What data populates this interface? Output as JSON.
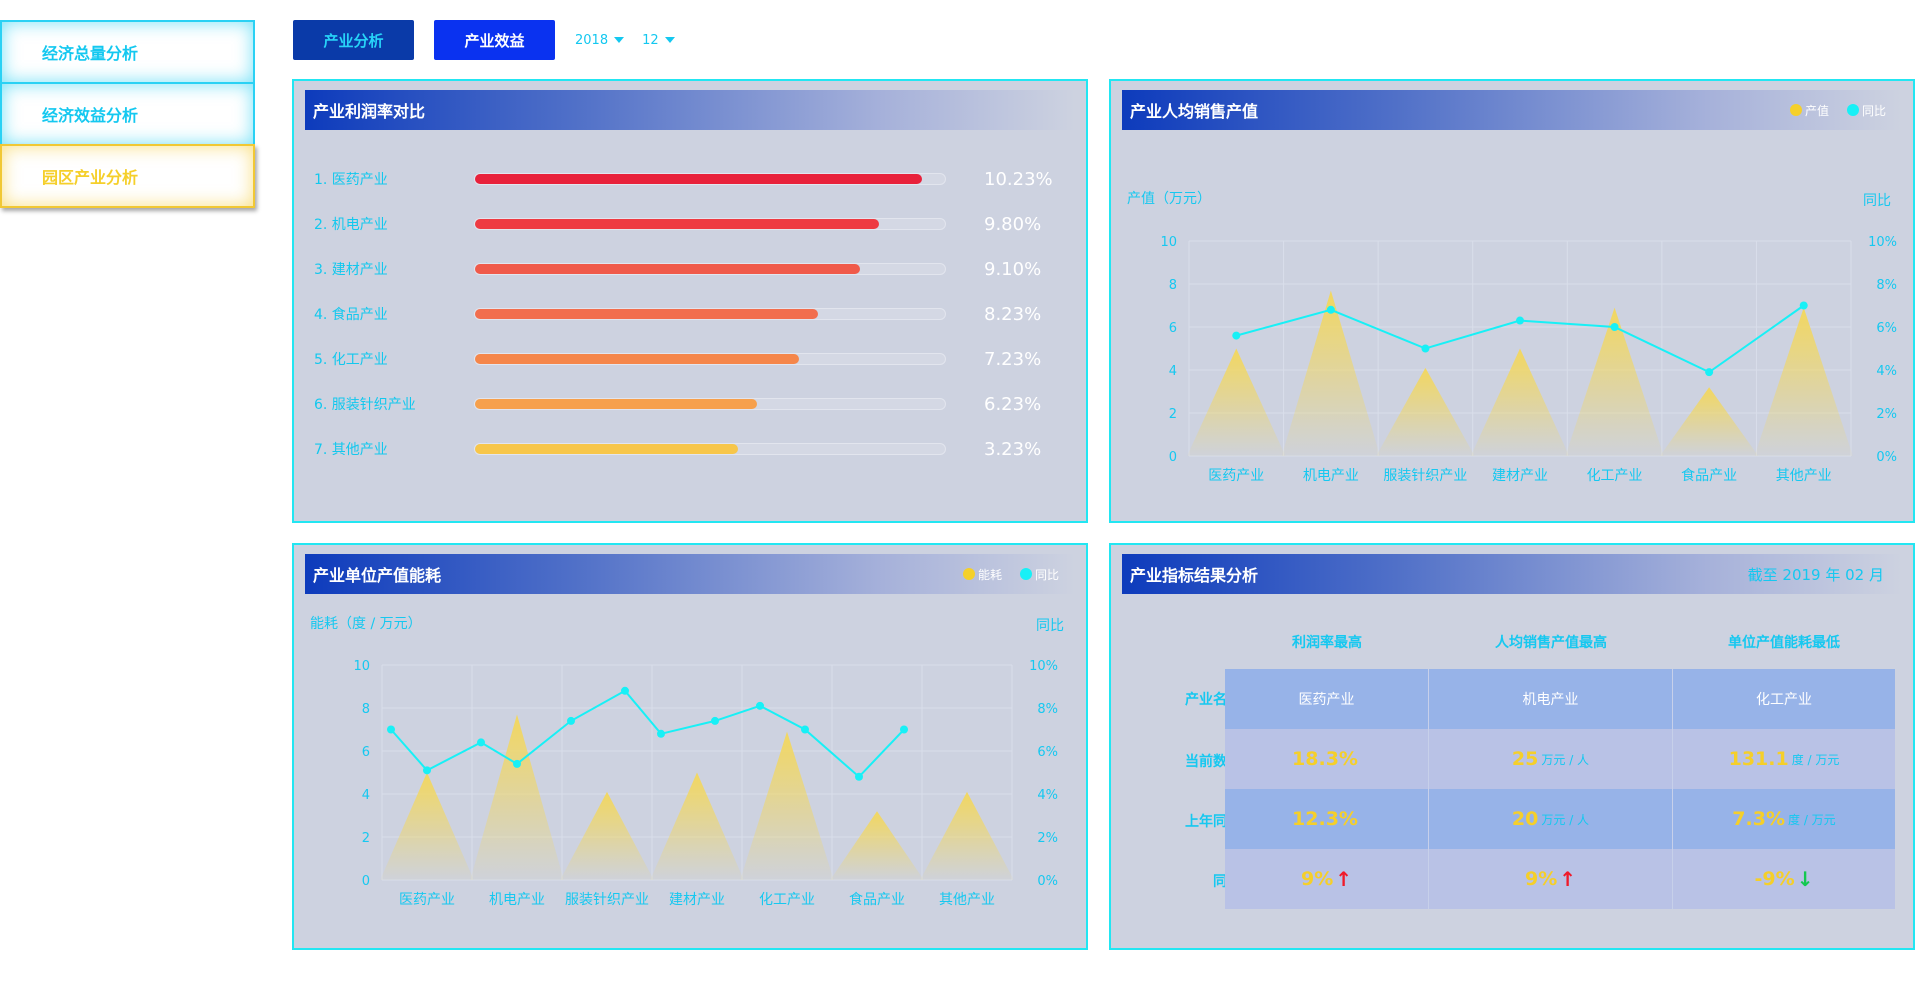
{
  "sidebar": {
    "items": [
      {
        "label": "经济总量分析"
      },
      {
        "label": "经济效益分析"
      },
      {
        "label": "园区产业分析"
      }
    ]
  },
  "top": {
    "tab_analysis": "产业分析",
    "tab_benefit": "产业效益",
    "year": "2018",
    "month": "12"
  },
  "profit_panel": {
    "title": "产业利润率对比",
    "items": [
      {
        "label": "1. 医药产业",
        "value": "10.23%",
        "fill": 0.95,
        "color": "#e8213b"
      },
      {
        "label": "2. 机电产业",
        "value": "9.80%",
        "fill": 0.86,
        "color": "#ee3a42"
      },
      {
        "label": "3. 建材产业",
        "value": "9.10%",
        "fill": 0.82,
        "color": "#f05a4a"
      },
      {
        "label": "4. 食品产业",
        "value": "8.23%",
        "fill": 0.73,
        "color": "#f26e4e"
      },
      {
        "label": "5. 化工产业",
        "value": "7.23%",
        "fill": 0.69,
        "color": "#f5864a"
      },
      {
        "label": "6. 服装针织产业",
        "value": "6.23%",
        "fill": 0.6,
        "color": "#f6a04c"
      },
      {
        "label": "7. 其他产业",
        "value": "3.23%",
        "fill": 0.56,
        "color": "#f7c64a"
      }
    ]
  },
  "sales_panel": {
    "title": "产业人均销售产值",
    "legend": [
      "产值",
      "同比"
    ],
    "y_left_label": "产值（万元）",
    "y_right_label": "同比"
  },
  "energy_panel": {
    "title": "产业单位产值能耗",
    "legend": [
      "能耗",
      "同比"
    ],
    "y_left_label": "能耗（度 / 万元）",
    "y_right_label": "同比"
  },
  "chart_data": [
    {
      "type": "bar",
      "title": "产业人均销售产值",
      "categories": [
        "医药产业",
        "机电产业",
        "服装针织产业",
        "建材产业",
        "化工产业",
        "食品产业",
        "其他产业"
      ],
      "series": [
        {
          "name": "产值",
          "values": [
            5,
            7.7,
            4.1,
            5,
            6.9,
            3.2,
            6.9
          ],
          "axis": "left"
        },
        {
          "name": "同比",
          "values": [
            5.6,
            6.8,
            5.0,
            6.3,
            6.0,
            3.9,
            7.0
          ],
          "axis": "right"
        }
      ],
      "ylim": [
        0,
        10
      ],
      "y_ticks": [
        "0",
        "2",
        "4",
        "6",
        "8",
        "10"
      ],
      "y2_ticks": [
        "0%",
        "2%",
        "4%",
        "6%",
        "8%",
        "10%"
      ],
      "colors": {
        "bar": "#f2d760",
        "line": "#18f0f6"
      }
    },
    {
      "type": "bar",
      "title": "产业单位产值能耗",
      "categories": [
        "医药产业",
        "机电产业",
        "服装针织产业",
        "建材产业",
        "化工产业",
        "食品产业",
        "其他产业"
      ],
      "series": [
        {
          "name": "能耗",
          "values": [
            5,
            7.7,
            4.1,
            5,
            6.9,
            3.2,
            4.1
          ],
          "axis": "left"
        },
        {
          "name": "同比",
          "x": [
            -0.4,
            0,
            0.6,
            1.0,
            1.6,
            2.2,
            2.6,
            3.2,
            3.7,
            4.2,
            4.8,
            5.3
          ],
          "values": [
            7.0,
            5.1,
            6.4,
            5.4,
            7.4,
            8.8,
            6.8,
            7.4,
            8.1,
            7.0,
            4.8,
            7.0
          ],
          "axis": "right"
        }
      ],
      "ylim": [
        0,
        10
      ],
      "y_ticks": [
        "0",
        "2",
        "4",
        "6",
        "8",
        "10"
      ],
      "y2_ticks": [
        "0%",
        "2%",
        "4%",
        "6%",
        "8%",
        "10%"
      ],
      "colors": {
        "bar": "#f2d760",
        "line": "#18f0f6"
      }
    }
  ],
  "result_panel": {
    "title": "产业指标结果分析",
    "date": "截至 2019 年 02 月",
    "col_heads": [
      "利润率最高",
      "人均销售产值最高",
      "单位产值能耗最低"
    ],
    "row_heads": [
      "产业名称",
      "当前数据",
      "上年同期",
      "同比"
    ],
    "names": [
      "医药产业",
      "机电产业",
      "化工产业"
    ],
    "current": [
      {
        "num": "18.3%",
        "unit": ""
      },
      {
        "num": "25",
        "unit": "万元 / 人"
      },
      {
        "num": "131.1",
        "unit": "度 / 万元"
      }
    ],
    "last_year": [
      {
        "num": "12.3%",
        "unit": ""
      },
      {
        "num": "20",
        "unit": "万元 / 人"
      },
      {
        "num": "7.3%",
        "unit": "度 / 万元"
      }
    ],
    "yoy": [
      "9%",
      "9%",
      "-9%"
    ]
  }
}
